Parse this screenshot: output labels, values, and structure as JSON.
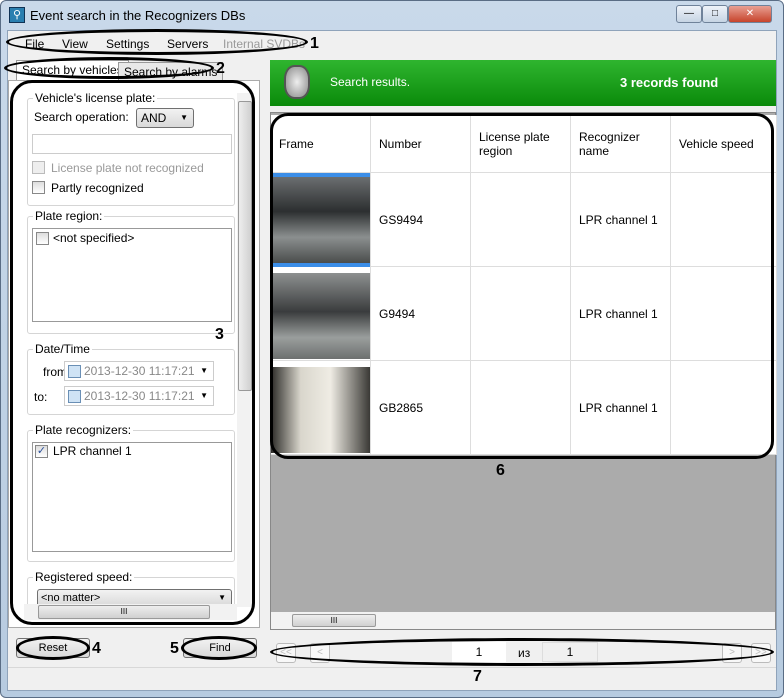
{
  "window": {
    "title": "Event search in the Recognizers DBs"
  },
  "menu": [
    "File",
    "View",
    "Settings",
    "Servers",
    "Internal SVDBs"
  ],
  "tabs": [
    "Search by vehicles",
    "Search by alarms"
  ],
  "filters": {
    "plate_group": "Vehicle's license plate:",
    "search_operation_label": "Search operation:",
    "search_operation_value": "AND",
    "plate_input_value": "",
    "not_recognized_label": "License plate not recognized",
    "partly_label": "Partly recognized",
    "region_group": "Plate region:",
    "region_items": [
      "<not specified>"
    ],
    "datetime_group": "Date/Time",
    "from_label": "from",
    "from_value": "2013-12-30 11:17:21",
    "to_label": "to:",
    "to_value": "2013-12-30 11:17:21",
    "recognizers_group": "Plate recognizers:",
    "recognizers": [
      {
        "label": "LPR channel 1",
        "checked": true
      }
    ],
    "speed_group": "Registered speed:",
    "speed_value": "<no matter>"
  },
  "buttons": {
    "reset": "Reset",
    "find": "Find"
  },
  "results": {
    "banner": "Search results.",
    "count": "3 records found",
    "banner_color": "#1fa11f"
  },
  "table": {
    "columns": [
      "Frame",
      "Number",
      "License plate region",
      "Recognizer name",
      "Vehicle speed"
    ],
    "rows": [
      {
        "number": "GS9494",
        "region": "",
        "recognizer": "LPR channel 1",
        "speed": ""
      },
      {
        "number": "G9494",
        "region": "",
        "recognizer": "LPR channel 1",
        "speed": ""
      },
      {
        "number": "GB2865",
        "region": "",
        "recognizer": "LPR channel 1",
        "speed": ""
      }
    ]
  },
  "pager": {
    "first": "<<",
    "prev": "<",
    "current": "1",
    "of": "из",
    "total": "1",
    "next": ">",
    "last": ">>"
  },
  "annotations": [
    "1",
    "2",
    "3",
    "4",
    "5",
    "6",
    "7"
  ],
  "scroll_grip": "III"
}
